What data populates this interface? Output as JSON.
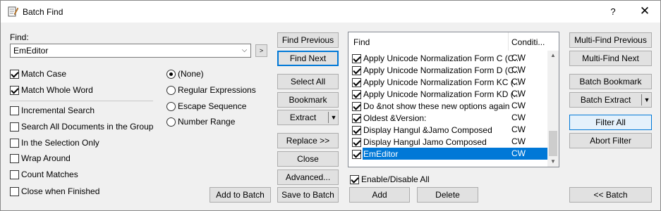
{
  "window": {
    "title": "Batch Find",
    "help_label": "?",
    "close_glyph": "✕"
  },
  "find": {
    "label": "Find:",
    "value": "EmEditor",
    "arrow": "⌵",
    "expand": ">"
  },
  "options": {
    "match_case": "Match Case",
    "match_whole_word": "Match Whole Word",
    "incremental": "Incremental Search",
    "search_all_docs": "Search All Documents in the Group",
    "in_selection": "In the Selection Only",
    "wrap_around": "Wrap Around",
    "count_matches": "Count Matches",
    "close_when_finished": "Close when Finished"
  },
  "modes": {
    "none": "(None)",
    "regex": "Regular Expressions",
    "escape": "Escape Sequence",
    "number_range": "Number Range"
  },
  "buttons": {
    "find_previous": "Find Previous",
    "find_next": "Find Next",
    "select_all": "Select All",
    "bookmark": "Bookmark",
    "extract": "Extract",
    "replace": "Replace >>",
    "close": "Close",
    "advanced": "Advanced...",
    "add_to_batch": "Add to Batch",
    "save_to_batch": "Save to Batch",
    "add": "Add",
    "delete": "Delete",
    "multi_find_previous": "Multi-Find Previous",
    "multi_find_next": "Multi-Find Next",
    "batch_bookmark": "Batch Bookmark",
    "batch_extract": "Batch Extract",
    "filter_all": "Filter All",
    "abort_filter": "Abort Filter",
    "batch": "<< Batch",
    "dropdown_glyph": "▼"
  },
  "list": {
    "col_find": "Find",
    "col_condition": "Conditi...",
    "rows": [
      {
        "find": "Apply Unicode Normalization Form C (C...",
        "cond": "CW"
      },
      {
        "find": "Apply Unicode Normalization Form D (C...",
        "cond": "CW"
      },
      {
        "find": "Apply Unicode Normalization Form KC (...",
        "cond": "CW"
      },
      {
        "find": "Apply Unicode Normalization Form KD (...",
        "cond": "CW"
      },
      {
        "find": "Do &not show these new options again",
        "cond": "CW"
      },
      {
        "find": "Oldest &Version:",
        "cond": "CW"
      },
      {
        "find": "Display Hangul &Jamo Composed",
        "cond": "CW"
      },
      {
        "find": "Display Hangul Jamo Composed",
        "cond": "CW"
      },
      {
        "find": "EmEditor",
        "cond": "CW"
      }
    ],
    "enable_disable": "Enable/Disable All"
  },
  "colors": {
    "accent": "#0078d7",
    "selection": "#0078d7"
  }
}
